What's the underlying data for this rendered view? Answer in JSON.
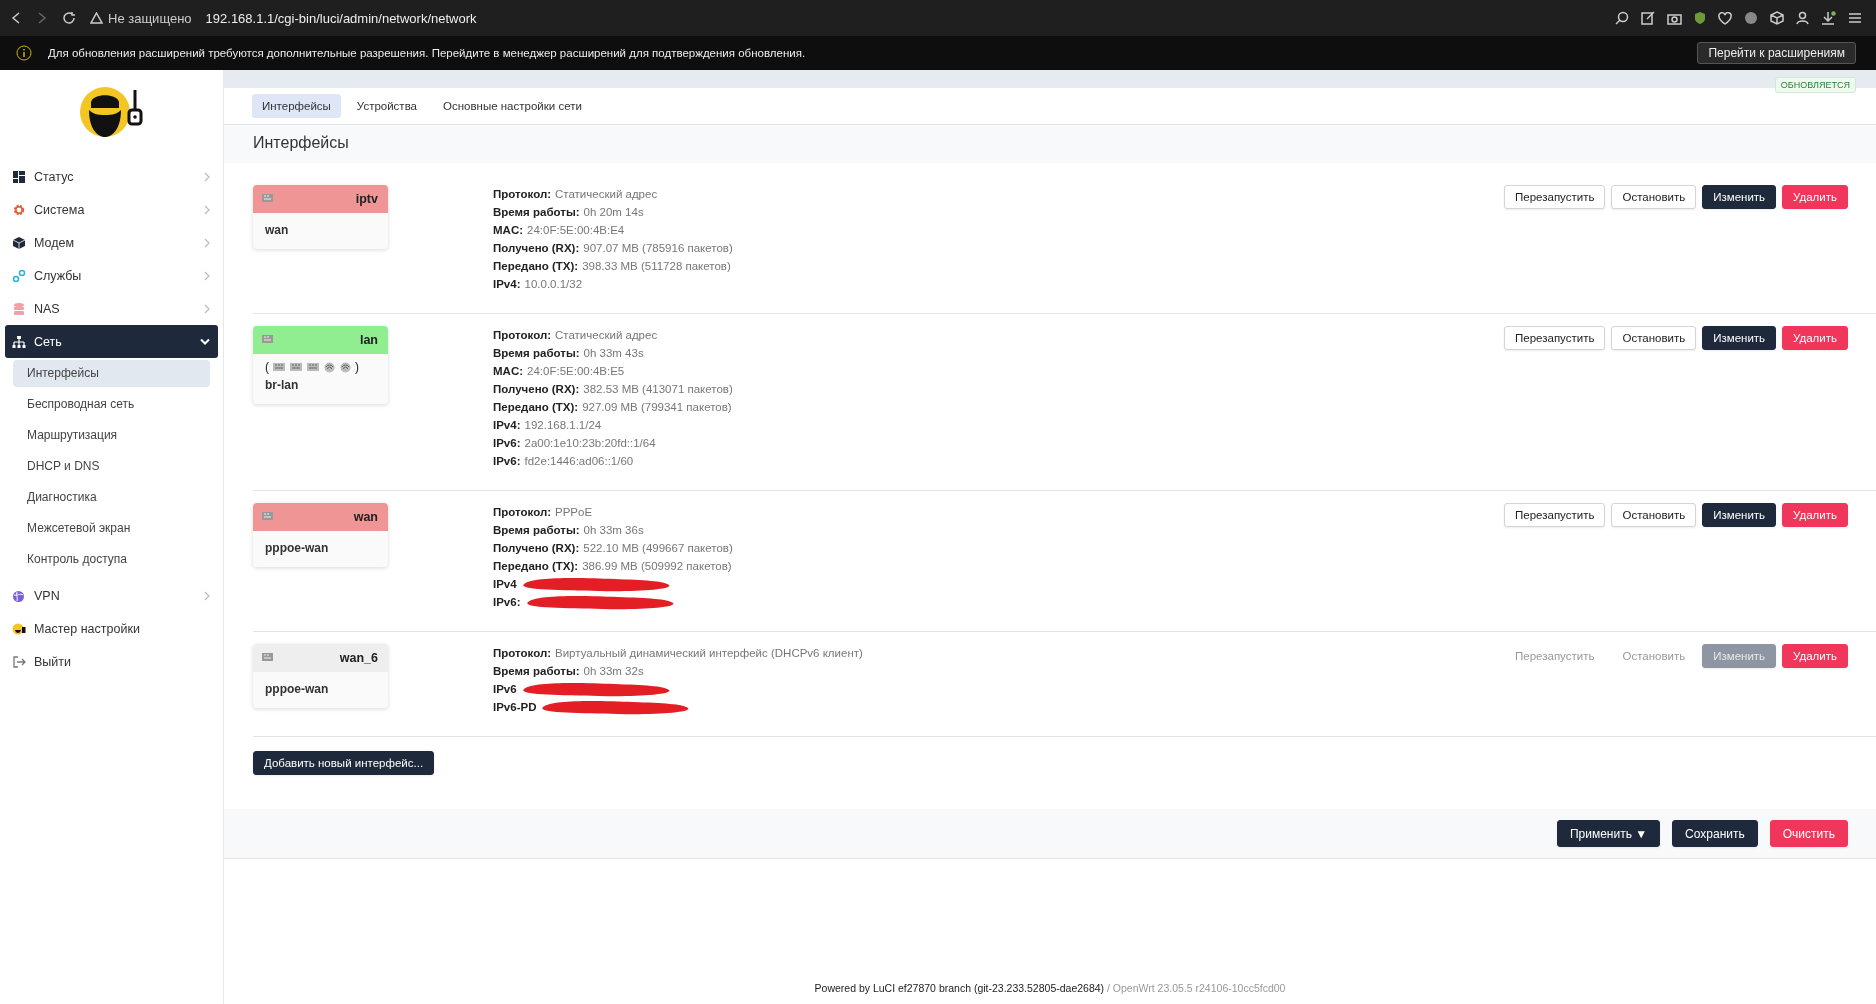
{
  "browser": {
    "security": "Не защищено",
    "url": "192.168.1.1/cgi-bin/luci/admin/network/network"
  },
  "notice": {
    "text": "Для обновления расширений требуются дополнительные разрешения. Перейдите в менеджер расширений для подтверждения обновления.",
    "button": "Перейти к расширениям"
  },
  "sidebar": {
    "items": [
      {
        "label": "Статус",
        "expanded": false
      },
      {
        "label": "Система",
        "expanded": false
      },
      {
        "label": "Модем",
        "expanded": false
      },
      {
        "label": "Службы",
        "expanded": false
      },
      {
        "label": "NAS",
        "expanded": false
      },
      {
        "label": "Сеть",
        "expanded": true,
        "children": [
          {
            "label": "Интерфейсы",
            "selected": true
          },
          {
            "label": "Беспроводная сеть",
            "selected": false
          },
          {
            "label": "Маршрутизация",
            "selected": false
          },
          {
            "label": "DHCP и DNS",
            "selected": false
          },
          {
            "label": "Диагностика",
            "selected": false
          },
          {
            "label": "Межсетевой экран",
            "selected": false
          },
          {
            "label": "Контроль доступа",
            "selected": false
          }
        ]
      },
      {
        "label": "VPN",
        "expanded": false
      },
      {
        "label": "Мастер настройки"
      },
      {
        "label": "Выйти"
      }
    ]
  },
  "status_badge": "ОБНОВЛЯЕТСЯ",
  "tabs": [
    {
      "label": "Интерфейсы",
      "selected": true
    },
    {
      "label": "Устройства",
      "selected": false
    },
    {
      "label": "Основные настройки сети",
      "selected": false
    }
  ],
  "section_title": "Интерфейсы",
  "interfaces": [
    {
      "name": "iptv",
      "color": "#f09595",
      "device": "wan",
      "details": [
        {
          "label": "Протокол:",
          "value": "Статический адрес"
        },
        {
          "label": "Время работы:",
          "value": "0h 20m 14s"
        },
        {
          "label": "MAC:",
          "value": "24:0F:5E:00:4B:E4"
        },
        {
          "label": "Получено (RX):",
          "value": "907.07 MB (785916 пакетов)"
        },
        {
          "label": "Передано (TX):",
          "value": "398.33 MB (511728 пакетов)"
        },
        {
          "label": "IPv4:",
          "value": "10.0.0.1/32"
        }
      ],
      "buttons": [
        {
          "label": "Перезапустить",
          "kind": "default",
          "disabled": false
        },
        {
          "label": "Остановить",
          "kind": "default",
          "disabled": false
        },
        {
          "label": "Изменить",
          "kind": "primary",
          "disabled": false
        },
        {
          "label": "Удалить",
          "kind": "danger",
          "disabled": false
        }
      ]
    },
    {
      "name": "lan",
      "color": "#90ee90",
      "ports_open": "(",
      "ports_close": ")",
      "ports": [
        {
          "kind": "ethernet"
        },
        {
          "kind": "ethernet"
        },
        {
          "kind": "ethernet"
        },
        {
          "kind": "wireless"
        },
        {
          "kind": "wireless"
        }
      ],
      "device": "br-lan",
      "details": [
        {
          "label": "Протокол:",
          "value": "Статический адрес"
        },
        {
          "label": "Время работы:",
          "value": "0h 33m 43s"
        },
        {
          "label": "MAC:",
          "value": "24:0F:5E:00:4B:E5"
        },
        {
          "label": "Получено (RX):",
          "value": "382.53 MB (413071 пакетов)"
        },
        {
          "label": "Передано (TX):",
          "value": "927.09 MB (799341 пакетов)"
        },
        {
          "label": "IPv4:",
          "value": "192.168.1.1/24"
        },
        {
          "label": "IPv6:",
          "value": "2a00:1e10:23b:20fd::1/64"
        },
        {
          "label": "IPv6:",
          "value": "fd2e:1446:ad06::1/60"
        }
      ],
      "buttons": [
        {
          "label": "Перезапустить",
          "kind": "default",
          "disabled": false
        },
        {
          "label": "Остановить",
          "kind": "default",
          "disabled": false
        },
        {
          "label": "Изменить",
          "kind": "primary",
          "disabled": false
        },
        {
          "label": "Удалить",
          "kind": "danger",
          "disabled": false
        }
      ]
    },
    {
      "name": "wan",
      "color": "#f09595",
      "device": "pppoe-wan",
      "details": [
        {
          "label": "Протокол:",
          "value": "PPPoE"
        },
        {
          "label": "Время работы:",
          "value": "0h 33m 36s"
        },
        {
          "label": "Получено (RX):",
          "value": "522.10 MB (499667 пакетов)"
        },
        {
          "label": "Передано (TX):",
          "value": "386.99 MB (509992 пакетов)"
        },
        {
          "label": "IPv4",
          "redacted": true
        },
        {
          "label": "IPv6:",
          "redacted": true
        }
      ],
      "buttons": [
        {
          "label": "Перезапустить",
          "kind": "default",
          "disabled": false
        },
        {
          "label": "Остановить",
          "kind": "default",
          "disabled": false
        },
        {
          "label": "Изменить",
          "kind": "primary",
          "disabled": false
        },
        {
          "label": "Удалить",
          "kind": "danger",
          "disabled": false
        }
      ]
    },
    {
      "name": "wan_6",
      "color": "#eeeeee",
      "device": "pppoe-wan",
      "details": [
        {
          "label": "Протокол:",
          "value": "Виртуальный динамический интерфейс (DHCPv6 клиент)"
        },
        {
          "label": "Время работы:",
          "value": "0h 33m 32s"
        },
        {
          "label": "IPv6",
          "redacted": true
        },
        {
          "label": "IPv6-PD",
          "redacted": true
        }
      ],
      "buttons": [
        {
          "label": "Перезапустить",
          "kind": "default",
          "disabled": true
        },
        {
          "label": "Остановить",
          "kind": "default",
          "disabled": true
        },
        {
          "label": "Изменить",
          "kind": "primary",
          "disabled": true
        },
        {
          "label": "Удалить",
          "kind": "danger",
          "disabled": false
        }
      ]
    }
  ],
  "add_button": "Добавить новый интерфейс...",
  "actions": [
    {
      "label": "Применить ▼",
      "kind": "primary"
    },
    {
      "label": "Сохранить",
      "kind": "primary"
    },
    {
      "label": "Очистить",
      "kind": "danger"
    }
  ],
  "footer": {
    "text": "Powered by LuCI ef27870 branch (git-23.233.52805-dae2684)",
    "version": "/ OpenWrt 23.05.5 r24106-10cc5fcd00"
  }
}
